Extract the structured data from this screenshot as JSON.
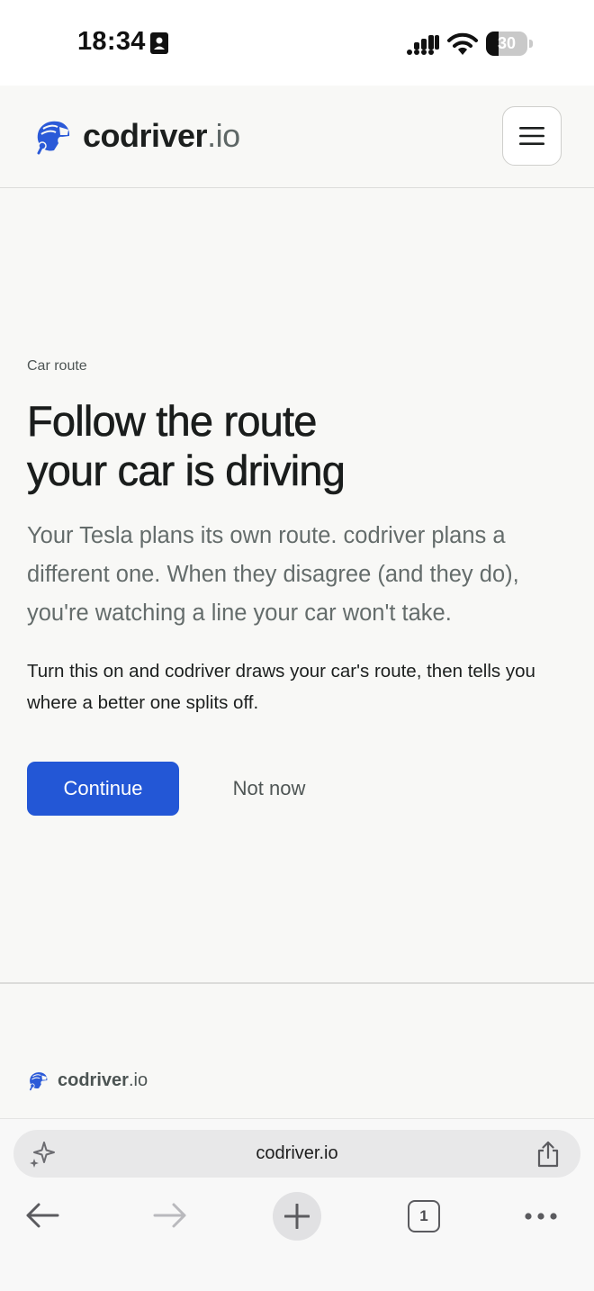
{
  "status_bar": {
    "time": "18:34",
    "battery_level": "30",
    "battery_fraction": 0.3
  },
  "header": {
    "brand_name": "codriver",
    "brand_tld": ".io",
    "menu_icon": "hamburger-menu-icon",
    "logo_icon": "helmet-logo-icon"
  },
  "main": {
    "eyebrow": "Car route",
    "headline_line1": "Follow the route",
    "headline_line2": "your car is driving",
    "lead": "Your Tesla plans its own route. codriver plans a different one. When they disagree (and they do), you're watching a line your car won't take.",
    "body": "Turn this on and codriver draws your car's route, then tells you where a better one splits off.",
    "continue_label": "Continue",
    "not_now_label": "Not now"
  },
  "footer": {
    "brand_name": "codriver",
    "brand_tld": ".io"
  },
  "browser": {
    "url": "codriver.io",
    "tab_count": "1"
  },
  "colors": {
    "accent": "#2357d6",
    "logo_blue": "#2b5ad8",
    "background": "#f8f8f6",
    "text_primary": "#1c1f1e",
    "text_muted": "#646c6b"
  }
}
